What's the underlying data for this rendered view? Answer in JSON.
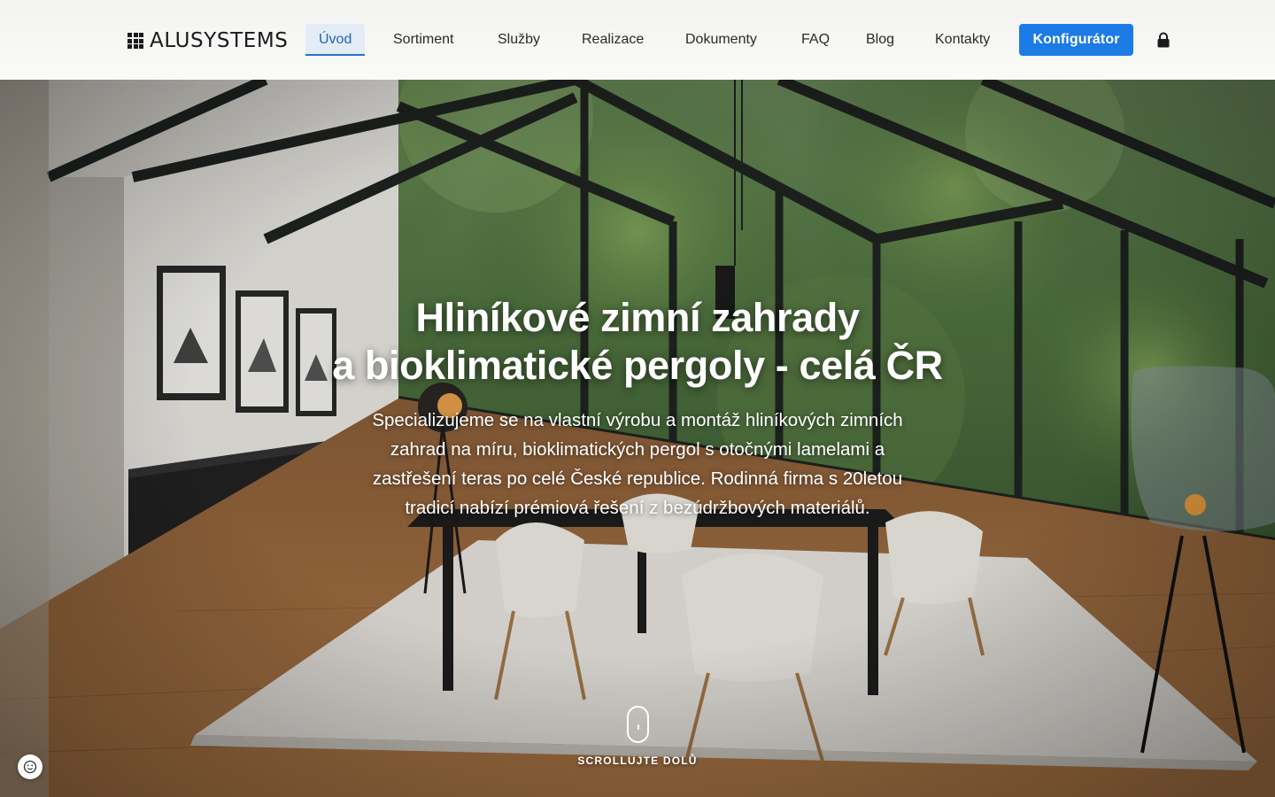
{
  "header": {
    "logo_text": "ALUSYSTEMS",
    "nav": [
      {
        "label": "Úvod",
        "active": true
      },
      {
        "label": "Sortiment"
      },
      {
        "label": "Služby"
      },
      {
        "label": "Realizace"
      },
      {
        "label": "Dokumenty"
      },
      {
        "label": "FAQ"
      },
      {
        "label": "Blog"
      },
      {
        "label": "Kontakty"
      }
    ],
    "cta_label": "Konfigurátor",
    "lock_icon": "lock-icon"
  },
  "hero": {
    "title_line1": "Hliníkové zimní zahrady",
    "title_line2": "a bioklimatické pergoly - celá ČR",
    "subtitle": "Specializujeme se na vlastní výrobu a montáž hliníkových zimních zahrad na míru, bioklimatických pergol s otočnými lamelami a zastřešení teras po celé České republice. Rodinná firma s 20letou tradicí nabízí prémiová řešení z bezúdržbových materiálů.",
    "scroll_label": "SCROLLUJTE DOLŮ",
    "scroll_icon": "mouse-scroll-icon"
  },
  "cookie": {
    "icon": "cookie-icon"
  },
  "colors": {
    "accent": "#1d7be6",
    "nav_active_bg": "#e4ecf7",
    "nav_active_text": "#2563b8",
    "header_bg": "#f6f6f4"
  }
}
